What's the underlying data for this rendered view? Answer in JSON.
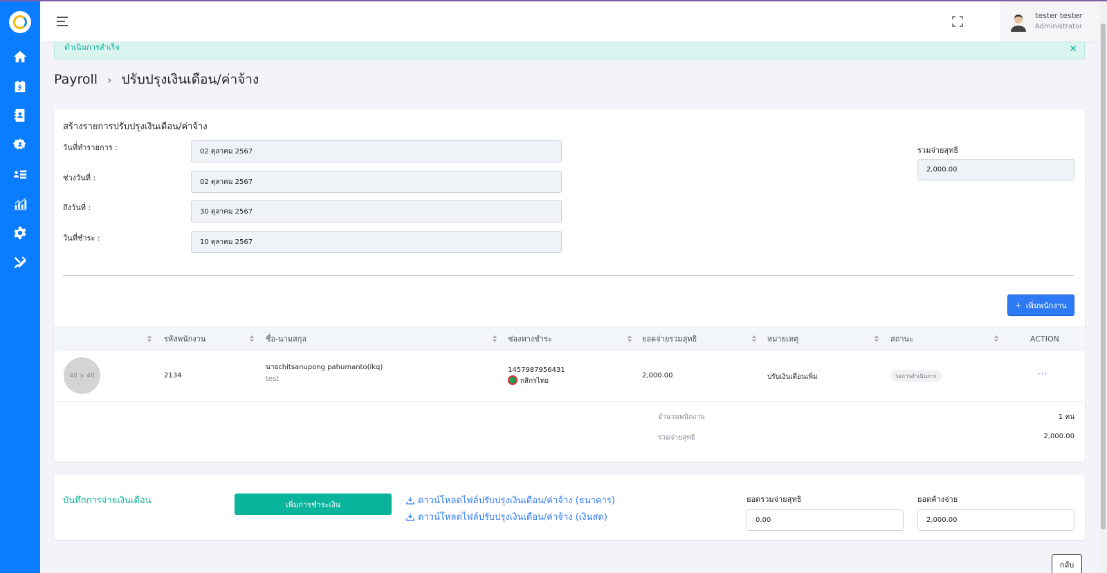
{
  "header": {
    "user_name": "tester tester",
    "user_role": "Administrator"
  },
  "alert": {
    "text": "ดำเนินการสำเร็จ"
  },
  "breadcrumb": {
    "root": "Payroll",
    "current": "ปรับปรุงเงินเดือน/ค่าจ้าง"
  },
  "form": {
    "title": "สร้างรายการปรับปรุงเงินเดือน/ค่าจ้าง",
    "transaction_date_label": "วันที่ทำรายการ :",
    "transaction_date": "02 ตุลาคม 2567",
    "period_start_label": "ช่วงวันที่ :",
    "period_start": "02 ตุลาคม 2567",
    "period_end_label": "ถึงวันที่ :",
    "period_end": "30 ตุลาคม 2567",
    "payment_date_label": "วันที่ชำระ :",
    "payment_date": "10 ตุลาคม 2567",
    "net_total_label": "รวมจ่ายสุทธิ",
    "net_total": "2,000.00",
    "add_employee_label": "เพิ่มพนักงาน"
  },
  "table": {
    "headers": [
      "รหัสพนักงาน",
      "ชื่อ-นามสกุล",
      "ช่องทางชำระ",
      "ยอดจ่ายรวมสุทธิ",
      "หมายเหตุ",
      "สถานะ",
      "ACTION"
    ],
    "rows": [
      {
        "avatar": "40 × 40",
        "employee_id": "2134",
        "name": "นายchitsanupong pahumanto(ikq)",
        "sub": "test",
        "account": "1457987956431",
        "bank": "กสิกรไทย",
        "net": "2,000.00",
        "note": "ปรับเงินเดือนเพิ่ม",
        "status": "รอการดำเนินการ",
        "action": "···"
      }
    ],
    "summary": {
      "employee_count_label": "จำนวนพนักงาน",
      "employee_count": "1 คน",
      "net_label": "รวมจ่ายสุทธิ",
      "net_value": "2,000.00"
    }
  },
  "payment": {
    "title": "บันทึกการจ่ายเงินเดือน",
    "add_payment_label": "เพิ่มการชำระเงิน",
    "download_bank": "ดาวน์โหลดไฟล์ปรับปรุงเงินเดือน/ค่าจ้าง (ธนาคาร)",
    "download_cash": "ดาวน์โหลดไฟล์ปรับปรุงเงินเดือน/ค่าจ้าง (เงินสด)",
    "net_total_label": "ยอดรวมจ่ายสุทธิ",
    "net_total": "0.00",
    "outstanding_label": "ยอดค้างจ่าย",
    "outstanding": "2,000.00"
  },
  "back_label": "กลับ",
  "colors": {
    "sidebar": "#0a7cff",
    "primary": "#2e7af5",
    "success": "#0ab39c"
  }
}
